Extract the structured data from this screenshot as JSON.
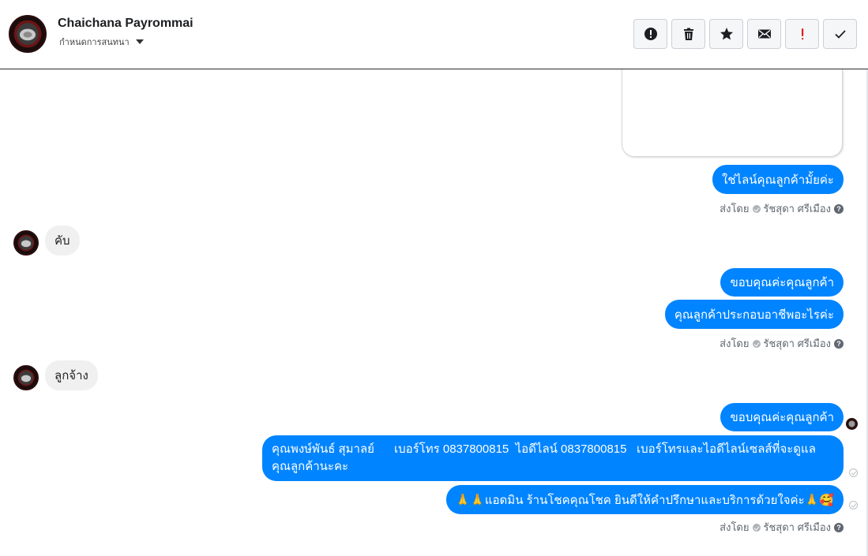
{
  "header": {
    "name": "Chaichana Payrommai",
    "subtitle": "กำหนดการสนทนา"
  },
  "toolbar": {
    "buttons": [
      {
        "name": "spam-icon"
      },
      {
        "name": "trash-icon"
      },
      {
        "name": "star-icon"
      },
      {
        "name": "mail-icon"
      },
      {
        "name": "important-icon"
      },
      {
        "name": "done-icon"
      }
    ]
  },
  "colors": {
    "outgoing_bubble": "#0084ff",
    "incoming_bubble": "#f1f0f0",
    "important_red": "#e02020"
  },
  "messages": {
    "m1": "ใช่ไลน์คุณลูกค้ามั้ยค่ะ",
    "sent1": {
      "prefix": "ส่งโดย",
      "agent": "รัชสุดา ศรีเมือง"
    },
    "in1": "คับ",
    "m2": "ขอบคุณค่ะคุณลูกค้า",
    "m3": "คุณลูกค้าประกอบอาชีพอะไรค่ะ",
    "sent2": {
      "prefix": "ส่งโดย",
      "agent": "รัชสุดา ศรีเมือง"
    },
    "in2": "ลูกจ้าง",
    "m4": "ขอบคุณค่ะคุณลูกค้า",
    "m5": "คุณพงษ์พันธ์ สุมาลย์      เบอร์โทร 0837800815  ไอดีไลน์ 0837800815   เบอร์โทรและไอดีไลน์เซลส์ที่จะดูแลคุณลูกค้านะคะ",
    "m6": "🙏🙏แอดมิน ร้านโชคคุณโชค ยินดีให้คำปรึกษาและบริการด้วยใจค่ะ🙏🥰",
    "sent3": {
      "prefix": "ส่งโดย",
      "agent": "รัชสุดา ศรีเมือง"
    }
  }
}
